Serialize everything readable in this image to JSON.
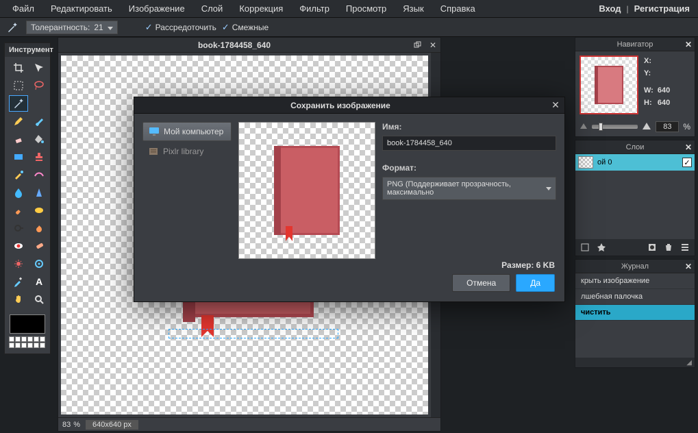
{
  "menubar": {
    "items": [
      "Файл",
      "Редактировать",
      "Изображение",
      "Слой",
      "Коррекция",
      "Фильтр",
      "Просмотр",
      "Язык",
      "Справка"
    ],
    "login": "Вход",
    "register": "Регистрация"
  },
  "optionsbar": {
    "tolerance_label": "Толерантность:",
    "tolerance_value": "21",
    "scatter_label": "Рассредоточить",
    "contiguous_label": "Смежные"
  },
  "tools_panel": {
    "title": "Инструмент"
  },
  "canvas": {
    "title": "book-1784458_640",
    "zoom": "83",
    "zoom_pct": "%",
    "dims": "640x640 px"
  },
  "nav_panel": {
    "title": "Навигатор",
    "x_label": "X:",
    "y_label": "Y:",
    "w_label": "W:",
    "h_label": "H:",
    "w_value": "640",
    "h_value": "640",
    "zoom_value": "83",
    "zoom_pct": "%"
  },
  "layers_panel": {
    "title": "Слои",
    "layer0_name": "ой 0"
  },
  "history_panel": {
    "title": "Журнал",
    "items": [
      "крыть изображение",
      "лшебная палочка",
      "чистить"
    ]
  },
  "modal": {
    "title": "Сохранить изображение",
    "left_my_computer": "Мой компьютер",
    "left_pixlr_library": "Pixlr library",
    "name_label": "Имя:",
    "name_value": "book-1784458_640",
    "format_label": "Формат:",
    "format_value": "PNG (Поддерживает прозрачность, максимально",
    "size_text": "Размер: 6 KB",
    "cancel": "Отмена",
    "ok": "Да"
  }
}
